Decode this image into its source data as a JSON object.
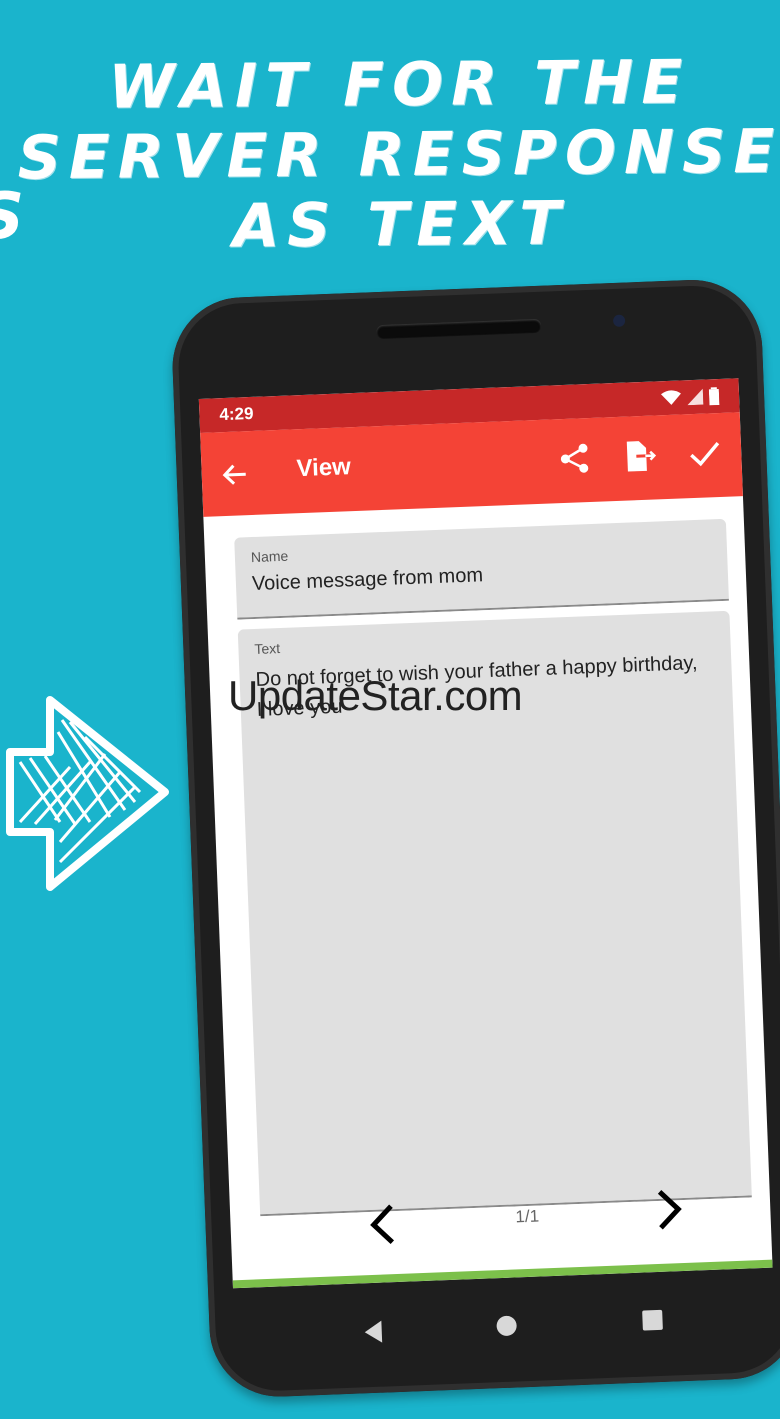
{
  "promo": {
    "headline_line1": "WAIT FOR THE",
    "headline_line2": "SERVER RESPONSE",
    "headline_line3": "AS TEXT",
    "edge_glyph": "S"
  },
  "status_bar": {
    "time": "4:29",
    "icons": [
      "wifi-icon",
      "signal-icon",
      "battery-icon"
    ]
  },
  "app_bar": {
    "title": "View",
    "actions": [
      "share-icon",
      "export-file-icon",
      "check-icon"
    ]
  },
  "form": {
    "name_label": "Name",
    "name_value": "Voice message from mom",
    "text_label": "Text",
    "text_value_line1": "Do not forget to wish your father a happy birthday,",
    "text_value_line2": "I love you"
  },
  "pager": {
    "page_indicator": "1/1"
  },
  "watermark": "UpdateStar.com",
  "colors": {
    "background": "#1ab4cc",
    "status_bar": "#c62828",
    "app_bar": "#f44336",
    "field_bg": "#e0e0e0",
    "accent_bar": "#7cc04b"
  }
}
